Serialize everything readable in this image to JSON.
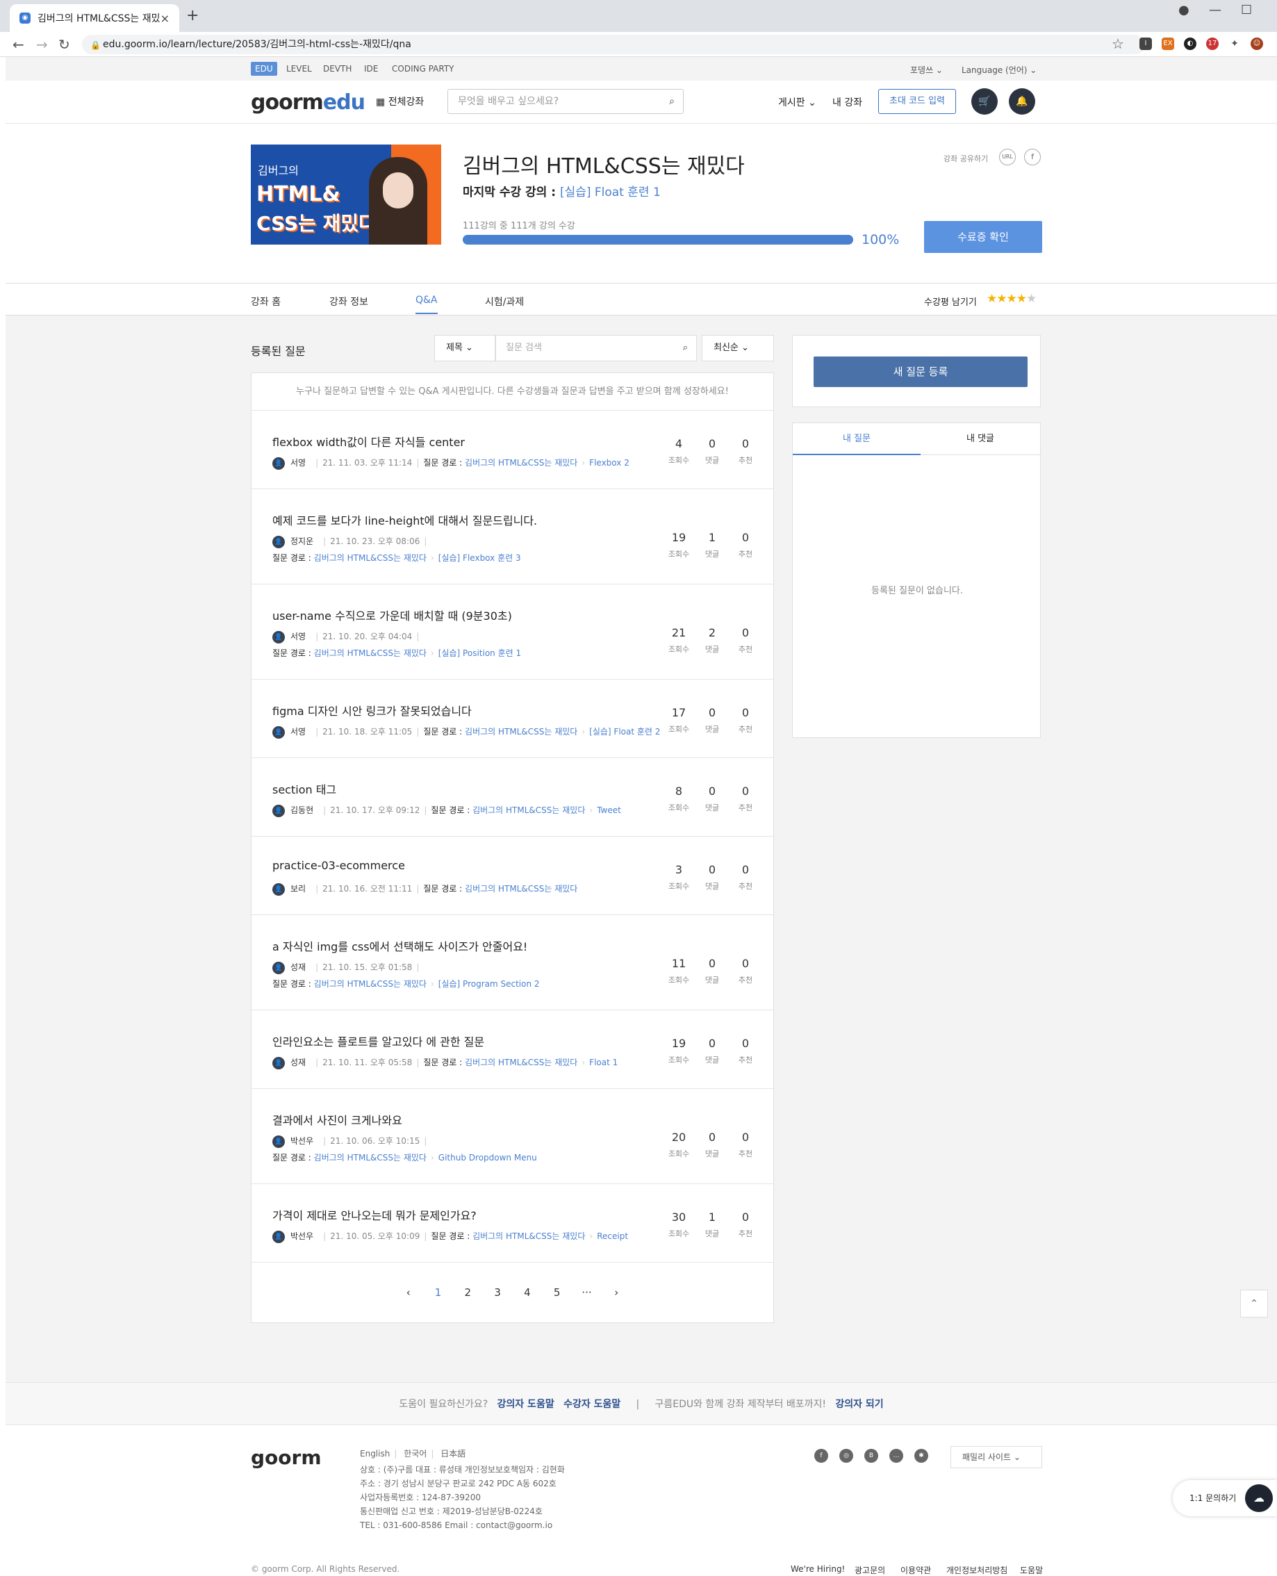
{
  "browser": {
    "tab_title": "김버그의 HTML&CSS는 재밌다",
    "tab_close": "×",
    "new_tab": "+",
    "url": "edu.goorm.io/learn/lecture/20583/김버그의-html-css는-재밌다/qna"
  },
  "gnb": {
    "items": [
      "EDU",
      "LEVEL",
      "DEVTH",
      "IDE",
      "CODING PARTY"
    ],
    "user": "포뎅쓰 ⌄",
    "language": "Language (언어) ⌄"
  },
  "header": {
    "logo_goorm": "goorm",
    "logo_edu": "edu",
    "all_courses": "전체강좌",
    "search_placeholder": "무엇을 배우고 싶으세요?",
    "board": "게시판 ⌄",
    "my_courses": "내 강좌",
    "invite_code": "초대 코드 입력"
  },
  "course": {
    "thumb_line1": "김버그의",
    "thumb_line2": "HTML&",
    "thumb_line3": "CSS는 재밌다",
    "title": "김버그의 HTML&CSS는 재밌다",
    "last_label": "마지막 수강 강의 : ",
    "last_link": "[실습] Float 훈련 1",
    "progress_label": "111강의 중 111개 강의 수강",
    "progress": 1.0,
    "progress_pct": "100%",
    "cert_button": "수료증 확인",
    "share_label": "강좌 공유하기",
    "share_url": "URL",
    "share_fb": "f"
  },
  "subnav": {
    "tabs": [
      "강좌 홈",
      "강좌 정보",
      "Q&A",
      "시험/과제"
    ],
    "review_label": "수강평 남기기",
    "rating": 4,
    "stars_filled": "★★★★",
    "stars_empty": "★"
  },
  "qna": {
    "section_title": "등록된 질문",
    "filter": "제목 ⌄",
    "search_placeholder": "질문 검색",
    "sort": "최신순 ⌄",
    "notice": "누구나 질문하고 답변할 수 있는 Q&A 게시판입니다. 다른 수강생들과 질문과 답변을 주고 받으며 함께 성장하세요!",
    "path_label": "질문 경로 : ",
    "stat_labels": [
      "조회수",
      "댓글",
      "추천"
    ],
    "questions": [
      {
        "title": "flexbox width값이 다른 자식들 center",
        "user": "서영",
        "date": "21. 11. 03. 오후 11:14",
        "course": "김버그의 HTML&CSS는 재밌다",
        "lecture": "Flexbox 2",
        "views": "4",
        "comments": "0",
        "likes": "0"
      },
      {
        "title": "예제 코드를 보다가 line-height에 대해서 질문드립니다.",
        "user": "정지운",
        "date": "21. 10. 23. 오후 08:06",
        "course": "김버그의 HTML&CSS는 재밌다",
        "lecture": "[실습] Flexbox 훈련 3",
        "views": "19",
        "comments": "1",
        "likes": "0"
      },
      {
        "title": "user-name 수직으로 가운데 배치할 때 (9분30초)",
        "user": "서영",
        "date": "21. 10. 20. 오후 04:04",
        "course": "김버그의 HTML&CSS는 재밌다",
        "lecture": "[실습] Position 훈련 1",
        "views": "21",
        "comments": "2",
        "likes": "0"
      },
      {
        "title": "figma 디자인 시안 링크가 잘못되었습니다",
        "user": "서영",
        "date": "21. 10. 18. 오후 11:05",
        "course": "김버그의 HTML&CSS는 재밌다",
        "lecture": "[실습] Float 훈련 2",
        "views": "17",
        "comments": "0",
        "likes": "0"
      },
      {
        "title": "section 태그",
        "user": "김동현",
        "date": "21. 10. 17. 오후 09:12",
        "course": "김버그의 HTML&CSS는 재밌다",
        "lecture": "Tweet",
        "views": "8",
        "comments": "0",
        "likes": "0"
      },
      {
        "title": "practice-03-ecommerce",
        "user": "보리",
        "date": "21. 10. 16. 오전 11:11",
        "course": "김버그의 HTML&CSS는 재밌다",
        "lecture": "",
        "views": "3",
        "comments": "0",
        "likes": "0"
      },
      {
        "title": "a 자식인 img를 css에서 선택해도 사이즈가 안줄어요!",
        "user": "성재",
        "date": "21. 10. 15. 오후 01:58",
        "course": "김버그의 HTML&CSS는 재밌다",
        "lecture": "[실습] Program Section 2",
        "views": "11",
        "comments": "0",
        "likes": "0"
      },
      {
        "title": "인라인요소는 플로트를 알고있다 에 관한 질문",
        "user": "성재",
        "date": "21. 10. 11. 오후 05:58",
        "course": "김버그의 HTML&CSS는 재밌다",
        "lecture": "Float 1",
        "views": "19",
        "comments": "0",
        "likes": "0"
      },
      {
        "title": "결과에서 사진이 크게나와요",
        "user": "박선우",
        "date": "21. 10. 06. 오후 10:15",
        "course": "김버그의 HTML&CSS는 재밌다",
        "lecture": "Github Dropdown Menu",
        "views": "20",
        "comments": "0",
        "likes": "0"
      },
      {
        "title": "가격이 제대로 안나오는데 뭐가 문제인가요?",
        "user": "박선우",
        "date": "21. 10. 05. 오후 10:09",
        "course": "김버그의 HTML&CSS는 재밌다",
        "lecture": "Receipt",
        "views": "30",
        "comments": "1",
        "likes": "0"
      }
    ],
    "pagination": [
      "‹",
      "1",
      "2",
      "3",
      "4",
      "5",
      "···",
      "›"
    ]
  },
  "sidebar": {
    "new_question": "새 질문 등록",
    "tab_my_questions": "내 질문",
    "tab_my_comments": "내 댓글",
    "empty": "등록된 질문이 없습니다."
  },
  "helpbar": {
    "need_help": "도움이 필요하신가요?",
    "instructor_help": "강의자 도움말",
    "student_help": "수강자 도움말",
    "divider": "|",
    "promo": "구름EDU와 함께 강좌 제작부터 배포까지!",
    "become_instructor": "강의자 되기"
  },
  "footer": {
    "logo": "goorm",
    "languages": [
      "English",
      "한국어",
      "日本語"
    ],
    "info": [
      "상호 : (주)구름     대표 : 류성태     개인정보보호책임자 : 김현화",
      "주소 : 경기 성남시 분당구 판교로 242 PDC A동 602호",
      "사업자등록번호 : 124-87-39200",
      "통신판매업 신고 번호 : 제2019-성남분당B-0224호",
      "TEL : 031-600-8586     Email : contact@goorm.io"
    ],
    "family_site": "패밀리 사이트 ⌄",
    "copyright": "© goorm Corp. All Rights Reserved.",
    "links": [
      "We're Hiring!",
      "광고문의",
      "이용약관",
      "개인정보처리방침",
      "도움말"
    ],
    "chat": "1:1 문의하기"
  },
  "colors": {
    "accent": "#4a80d0",
    "primary_button": "#4a72a8",
    "cert_button": "#5b93e0"
  }
}
